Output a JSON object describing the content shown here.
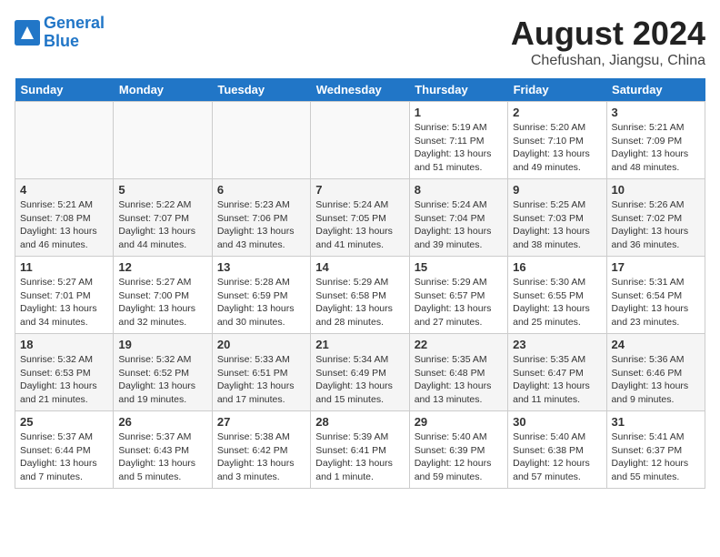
{
  "header": {
    "logo_line1": "General",
    "logo_line2": "Blue",
    "title": "August 2024",
    "subtitle": "Chefushan, Jiangsu, China"
  },
  "days_of_week": [
    "Sunday",
    "Monday",
    "Tuesday",
    "Wednesday",
    "Thursday",
    "Friday",
    "Saturday"
  ],
  "weeks": [
    [
      {
        "day": "",
        "info": ""
      },
      {
        "day": "",
        "info": ""
      },
      {
        "day": "",
        "info": ""
      },
      {
        "day": "",
        "info": ""
      },
      {
        "day": "1",
        "info": "Sunrise: 5:19 AM\nSunset: 7:11 PM\nDaylight: 13 hours and 51 minutes."
      },
      {
        "day": "2",
        "info": "Sunrise: 5:20 AM\nSunset: 7:10 PM\nDaylight: 13 hours and 49 minutes."
      },
      {
        "day": "3",
        "info": "Sunrise: 5:21 AM\nSunset: 7:09 PM\nDaylight: 13 hours and 48 minutes."
      }
    ],
    [
      {
        "day": "4",
        "info": "Sunrise: 5:21 AM\nSunset: 7:08 PM\nDaylight: 13 hours and 46 minutes."
      },
      {
        "day": "5",
        "info": "Sunrise: 5:22 AM\nSunset: 7:07 PM\nDaylight: 13 hours and 44 minutes."
      },
      {
        "day": "6",
        "info": "Sunrise: 5:23 AM\nSunset: 7:06 PM\nDaylight: 13 hours and 43 minutes."
      },
      {
        "day": "7",
        "info": "Sunrise: 5:24 AM\nSunset: 7:05 PM\nDaylight: 13 hours and 41 minutes."
      },
      {
        "day": "8",
        "info": "Sunrise: 5:24 AM\nSunset: 7:04 PM\nDaylight: 13 hours and 39 minutes."
      },
      {
        "day": "9",
        "info": "Sunrise: 5:25 AM\nSunset: 7:03 PM\nDaylight: 13 hours and 38 minutes."
      },
      {
        "day": "10",
        "info": "Sunrise: 5:26 AM\nSunset: 7:02 PM\nDaylight: 13 hours and 36 minutes."
      }
    ],
    [
      {
        "day": "11",
        "info": "Sunrise: 5:27 AM\nSunset: 7:01 PM\nDaylight: 13 hours and 34 minutes."
      },
      {
        "day": "12",
        "info": "Sunrise: 5:27 AM\nSunset: 7:00 PM\nDaylight: 13 hours and 32 minutes."
      },
      {
        "day": "13",
        "info": "Sunrise: 5:28 AM\nSunset: 6:59 PM\nDaylight: 13 hours and 30 minutes."
      },
      {
        "day": "14",
        "info": "Sunrise: 5:29 AM\nSunset: 6:58 PM\nDaylight: 13 hours and 28 minutes."
      },
      {
        "day": "15",
        "info": "Sunrise: 5:29 AM\nSunset: 6:57 PM\nDaylight: 13 hours and 27 minutes."
      },
      {
        "day": "16",
        "info": "Sunrise: 5:30 AM\nSunset: 6:55 PM\nDaylight: 13 hours and 25 minutes."
      },
      {
        "day": "17",
        "info": "Sunrise: 5:31 AM\nSunset: 6:54 PM\nDaylight: 13 hours and 23 minutes."
      }
    ],
    [
      {
        "day": "18",
        "info": "Sunrise: 5:32 AM\nSunset: 6:53 PM\nDaylight: 13 hours and 21 minutes."
      },
      {
        "day": "19",
        "info": "Sunrise: 5:32 AM\nSunset: 6:52 PM\nDaylight: 13 hours and 19 minutes."
      },
      {
        "day": "20",
        "info": "Sunrise: 5:33 AM\nSunset: 6:51 PM\nDaylight: 13 hours and 17 minutes."
      },
      {
        "day": "21",
        "info": "Sunrise: 5:34 AM\nSunset: 6:49 PM\nDaylight: 13 hours and 15 minutes."
      },
      {
        "day": "22",
        "info": "Sunrise: 5:35 AM\nSunset: 6:48 PM\nDaylight: 13 hours and 13 minutes."
      },
      {
        "day": "23",
        "info": "Sunrise: 5:35 AM\nSunset: 6:47 PM\nDaylight: 13 hours and 11 minutes."
      },
      {
        "day": "24",
        "info": "Sunrise: 5:36 AM\nSunset: 6:46 PM\nDaylight: 13 hours and 9 minutes."
      }
    ],
    [
      {
        "day": "25",
        "info": "Sunrise: 5:37 AM\nSunset: 6:44 PM\nDaylight: 13 hours and 7 minutes."
      },
      {
        "day": "26",
        "info": "Sunrise: 5:37 AM\nSunset: 6:43 PM\nDaylight: 13 hours and 5 minutes."
      },
      {
        "day": "27",
        "info": "Sunrise: 5:38 AM\nSunset: 6:42 PM\nDaylight: 13 hours and 3 minutes."
      },
      {
        "day": "28",
        "info": "Sunrise: 5:39 AM\nSunset: 6:41 PM\nDaylight: 13 hours and 1 minute."
      },
      {
        "day": "29",
        "info": "Sunrise: 5:40 AM\nSunset: 6:39 PM\nDaylight: 12 hours and 59 minutes."
      },
      {
        "day": "30",
        "info": "Sunrise: 5:40 AM\nSunset: 6:38 PM\nDaylight: 12 hours and 57 minutes."
      },
      {
        "day": "31",
        "info": "Sunrise: 5:41 AM\nSunset: 6:37 PM\nDaylight: 12 hours and 55 minutes."
      }
    ]
  ]
}
